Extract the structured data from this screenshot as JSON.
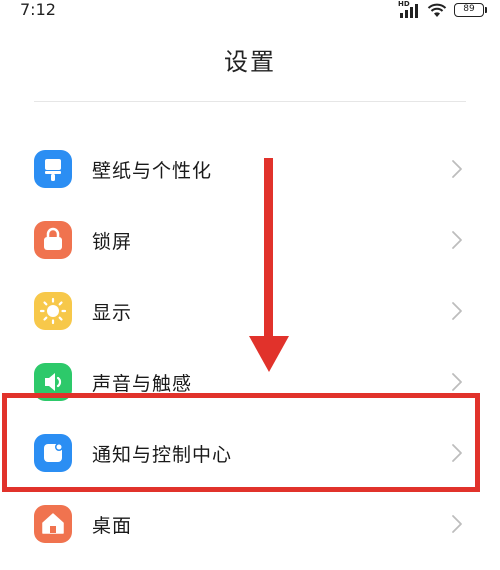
{
  "status_bar": {
    "time": "7:12",
    "network": "HD",
    "battery": "89"
  },
  "page": {
    "title": "设置"
  },
  "settings": {
    "items": [
      {
        "label": "壁纸与个性化",
        "icon": "wallpaper-icon",
        "color": "#2b8ef3"
      },
      {
        "label": "锁屏",
        "icon": "lock-icon",
        "color": "#f0734f"
      },
      {
        "label": "显示",
        "icon": "sun-icon",
        "color": "#f7c84a"
      },
      {
        "label": "声音与触感",
        "icon": "speaker-icon",
        "color": "#2dc96a"
      },
      {
        "label": "通知与控制中心",
        "icon": "notification-icon",
        "color": "#2b8ef3"
      },
      {
        "label": "桌面",
        "icon": "home-icon",
        "color": "#f0734f"
      }
    ]
  },
  "annotation": {
    "arrow_color": "#e1322b",
    "highlight_color": "#e1322b",
    "highlighted_item": "通知与控制中心"
  }
}
